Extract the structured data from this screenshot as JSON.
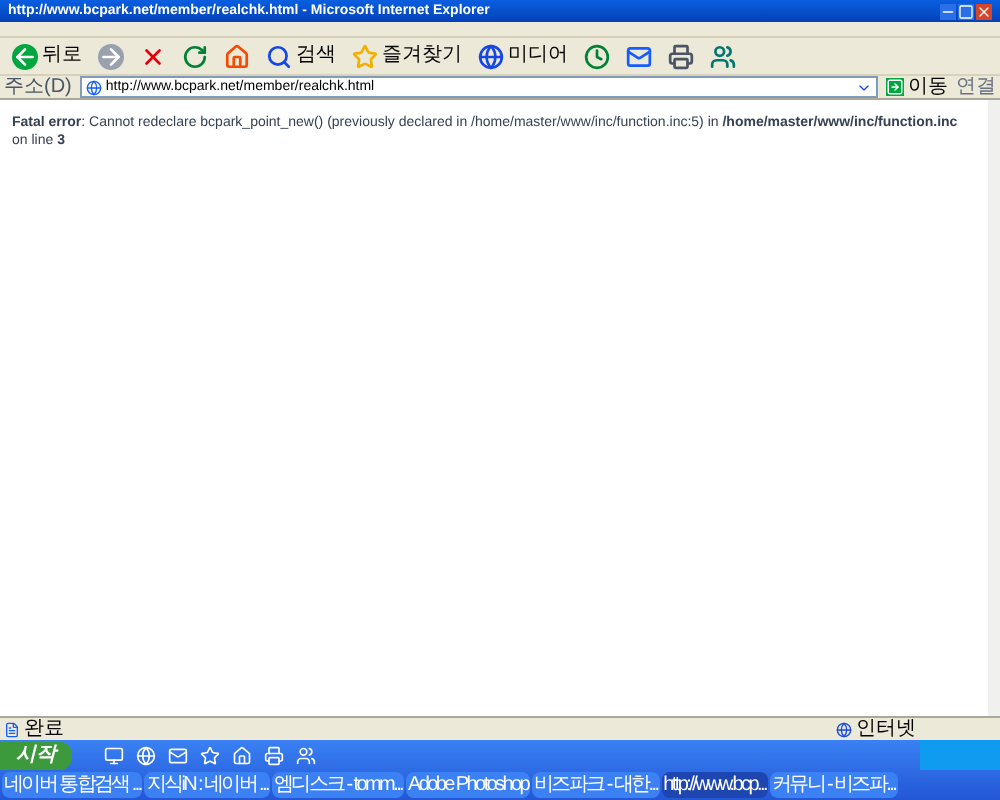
{
  "window": {
    "title": "http://www.bcpark.net/member/realchk.html - Microsoft Internet Explorer"
  },
  "toolbar": {
    "buttons": [
      {
        "kind": "back",
        "label": "뒤로"
      },
      {
        "kind": "forward"
      },
      {
        "kind": "stop"
      },
      {
        "kind": "refresh"
      },
      {
        "kind": "home"
      },
      {
        "kind": "search",
        "label": "검색"
      },
      {
        "kind": "favorites",
        "label": "즐겨찾기"
      },
      {
        "kind": "media",
        "label": "미디어"
      },
      {
        "kind": "history"
      },
      {
        "kind": "mail"
      },
      {
        "kind": "print"
      },
      {
        "kind": "messenger"
      }
    ]
  },
  "address_bar": {
    "label": "주소(D)",
    "value": "http://www.bcpark.net/member/realchk.html",
    "go": "이동",
    "links": "연결"
  },
  "content": {
    "message": "**Fatal error**: Cannot redeclare bcpark_point_new() (previously declared in /home/master/www/inc/function.inc:5) in **/home/master/www/inc/function.inc** on line **3**"
  },
  "status_bar": {
    "status": "완료",
    "zone": "인터넷"
  },
  "taskbar": {
    "start": "시작",
    "tasks": [
      {
        "label": "네이버 통합검색 ...",
        "selected": false
      },
      {
        "label": "지식iN : 네이버 ...",
        "selected": false
      },
      {
        "label": "엠디스크 - tomm...",
        "selected": false
      },
      {
        "label": "Adobe Photoshop",
        "selected": false
      },
      {
        "label": "비즈파크 - 대한...",
        "selected": false
      },
      {
        "label": "http://www.bcp...",
        "selected": true
      },
      {
        "label": "커뮤니 - 비즈파...",
        "selected": false
      }
    ]
  }
}
